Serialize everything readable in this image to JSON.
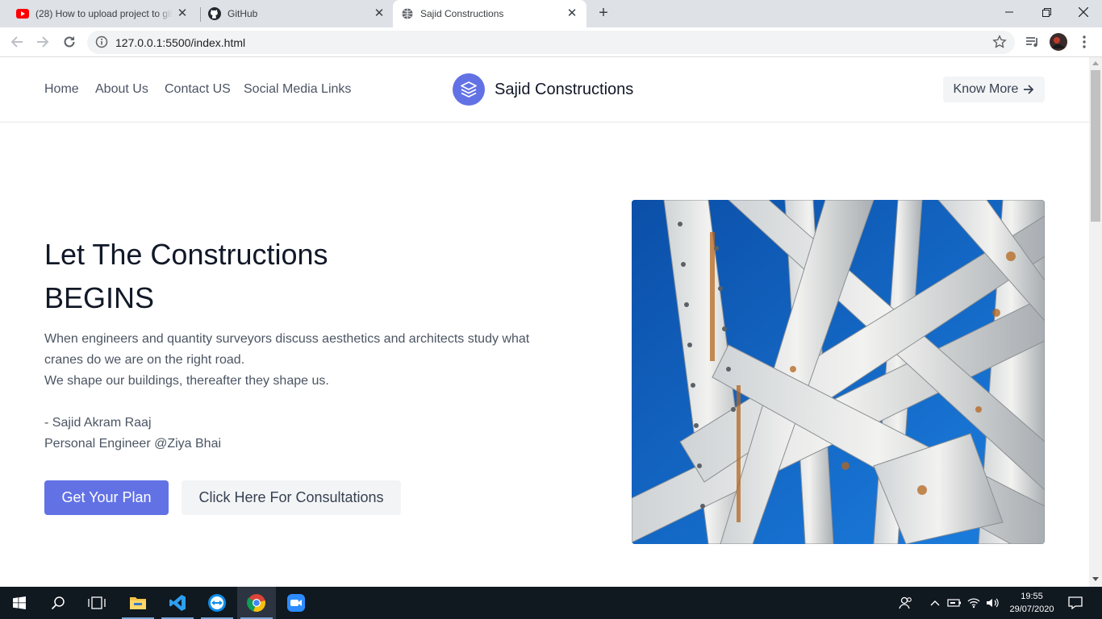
{
  "browser": {
    "tabs": [
      {
        "title": "(28) How to upload project to git",
        "icon": "youtube-icon"
      },
      {
        "title": "GitHub",
        "icon": "github-icon"
      },
      {
        "title": "Sajid Constructions",
        "icon": "globe-icon"
      }
    ],
    "close_glyph": "✕",
    "new_tab_glyph": "+",
    "url": "127.0.0.1:5500/index.html"
  },
  "site": {
    "nav": [
      "Home",
      "About Us",
      "Contact US",
      "Social Media Links"
    ],
    "brand": "Sajid Constructions",
    "know_more": "Know More",
    "hero": {
      "title_line1": "Let The Constructions",
      "title_line2": "BEGINS",
      "para_line1": "When engineers and quantity surveyors discuss aesthetics and architects study what",
      "para_line2": "cranes do we are on the right road.",
      "para_line3": "We shape our buildings, thereafter they shape us.",
      "author": "- Sajid Akram Raaj",
      "author_title": "Personal Engineer @Ziya Bhai",
      "btn_primary": "Get Your Plan",
      "btn_secondary": "Click Here For Consultations"
    }
  },
  "taskbar": {
    "time": "19:55",
    "date": "29/07/2020"
  },
  "colors": {
    "accent": "#6272e5",
    "taskbar": "#101820",
    "tabbar": "#dee1e6"
  }
}
